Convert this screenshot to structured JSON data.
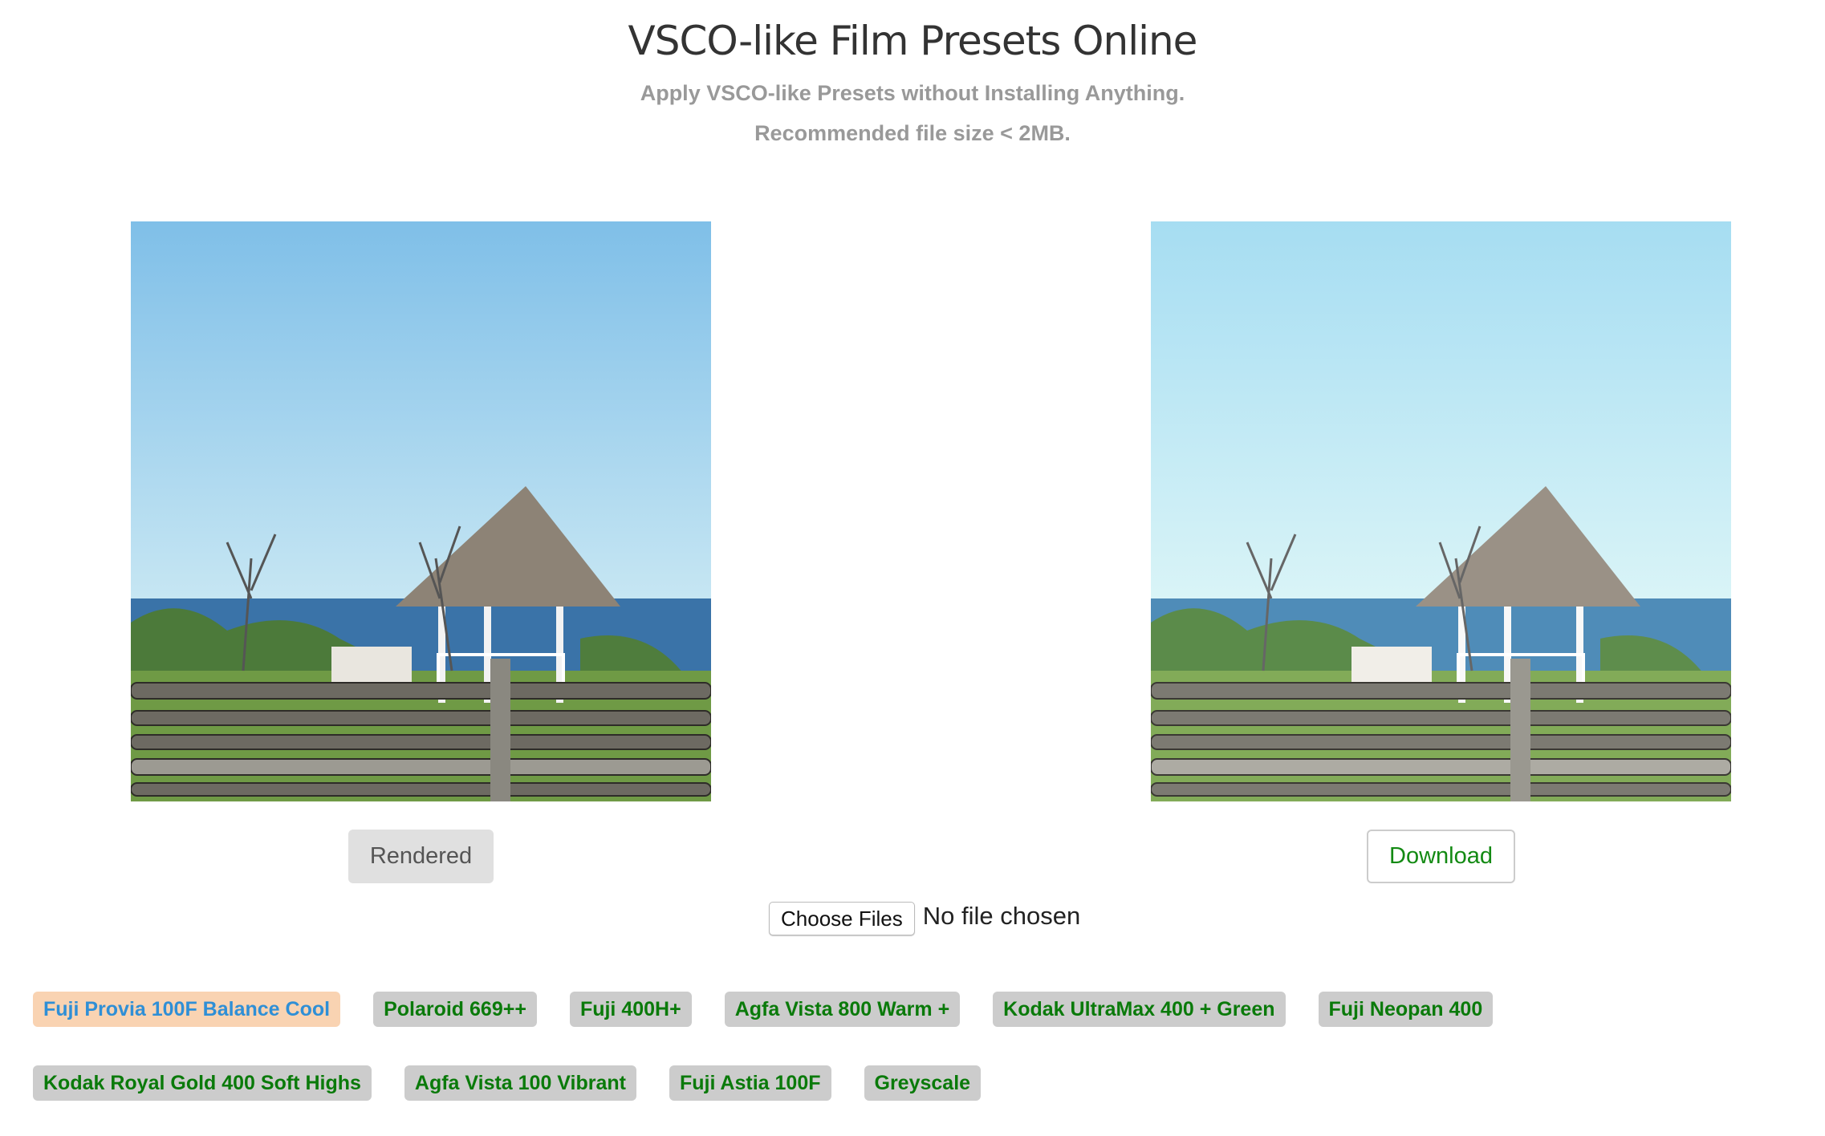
{
  "header": {
    "title": "VSCO-like Film Presets Online",
    "subtitle": "Apply VSCO-like Presets without Installing Anything.",
    "note": "Recommended file size < 2MB."
  },
  "images": {
    "original_alt": "Original photo: thatched gazebo by the sea behind wooden fence",
    "processed_alt": "Processed photo with film preset applied"
  },
  "buttons": {
    "rendered": "Rendered",
    "download": "Download"
  },
  "file_input": {
    "button_label": "Choose Files",
    "status": "No file chosen"
  },
  "presets": [
    {
      "label": "Fuji Provia 100F Balance Cool",
      "active": true
    },
    {
      "label": "Polaroid 669++",
      "active": false
    },
    {
      "label": "Fuji 400H+",
      "active": false
    },
    {
      "label": "Agfa Vista 800 Warm +",
      "active": false
    },
    {
      "label": "Kodak UltraMax 400 + Green",
      "active": false
    },
    {
      "label": "Fuji Neopan 400",
      "active": false
    },
    {
      "label": "Kodak Royal Gold 400 Soft Highs",
      "active": false
    },
    {
      "label": "Agfa Vista 100 Vibrant",
      "active": false
    },
    {
      "label": "Fuji Astia 100F",
      "active": false
    },
    {
      "label": "Greyscale",
      "active": false
    }
  ],
  "colors": {
    "active_preset_bg": "#f9d3b2",
    "active_preset_text": "#2f8fd6",
    "preset_bg": "#cccccc",
    "preset_text": "#0a7a0a",
    "download_text": "#138a13"
  }
}
